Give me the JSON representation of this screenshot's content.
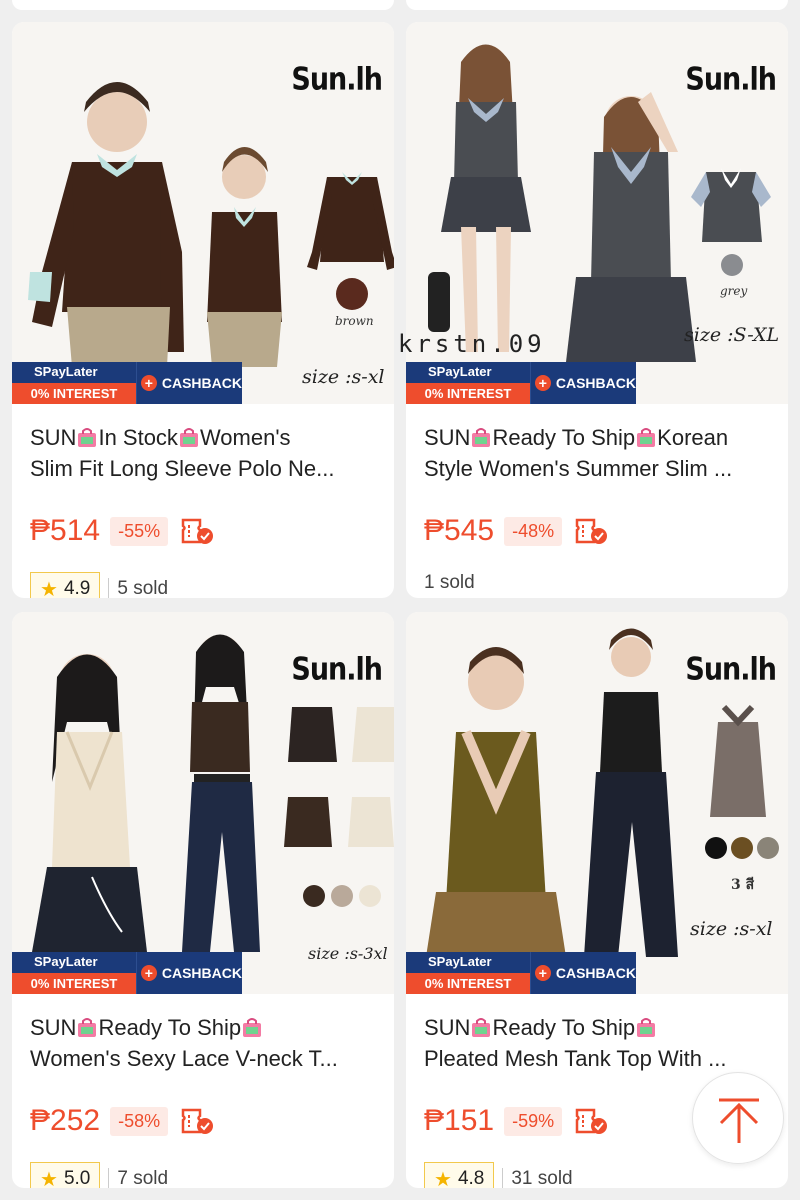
{
  "brand_color": "#ee4d2d",
  "spay_color": "#1b3a7a",
  "brand_logo": "Sun.lh",
  "promo": {
    "spay": "SPayLater",
    "interest": "0% INTEREST",
    "cashback": "CASHBACK"
  },
  "watermark": "krstn.09",
  "products": [
    {
      "title_a": "SUN",
      "title_b": "In Stock",
      "title_c": "Women's",
      "title_line2": "Slim Fit Long Sleeve Polo Ne...",
      "price": "₱514",
      "discount": "-55%",
      "rating": "4.9",
      "sold": "5 sold",
      "size_text": "size :s-xl",
      "swatch_label": "brown"
    },
    {
      "title_a": "SUN",
      "title_b": "Ready To Ship",
      "title_c": "Korean",
      "title_line2": "Style Women's Summer Slim ...",
      "price": "₱545",
      "discount": "-48%",
      "sold": "1 sold",
      "size_text": "size :S-XL",
      "swatch_label": "grey"
    },
    {
      "title_a": "SUN",
      "title_b": "Ready To Ship",
      "title_c": "",
      "title_line2": "Women's Sexy Lace V-neck T...",
      "price": "₱252",
      "discount": "-58%",
      "rating": "5.0",
      "sold": "7 sold",
      "size_text": "size :s-3xl"
    },
    {
      "title_a": "SUN",
      "title_b": "Ready To Ship",
      "title_c": "",
      "title_line2": "Pleated Mesh Tank Top With ...",
      "price": "₱151",
      "discount": "-59%",
      "rating": "4.8",
      "sold": "31 sold",
      "size_text": "size :s-xl",
      "swatch_label": "3 สี"
    }
  ],
  "icons": {
    "bag": "shopping-bag-icon",
    "voucher": "voucher-check-icon",
    "star": "star-icon",
    "back_to_top": "arrow-up-icon"
  }
}
